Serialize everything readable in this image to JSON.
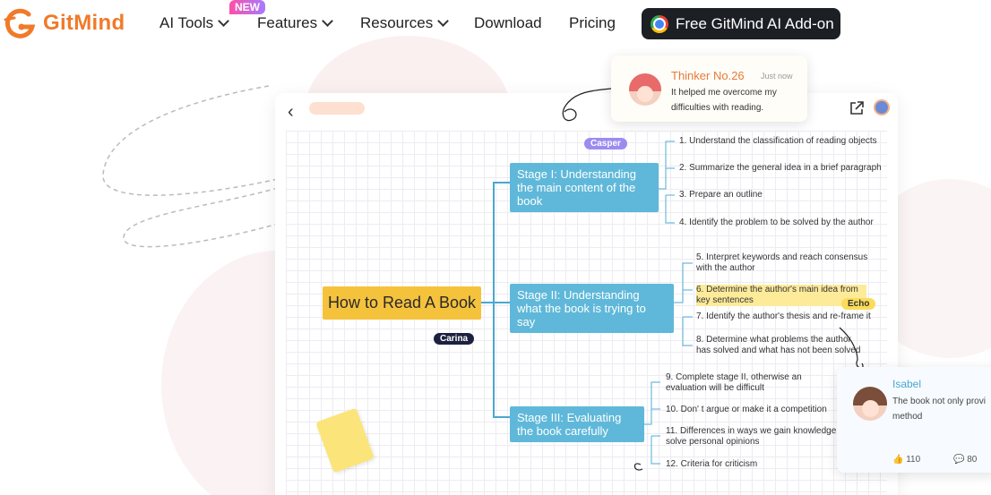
{
  "brand": {
    "name": "GitMind",
    "accent": "#f07a2a"
  },
  "nav": {
    "items": [
      {
        "label": "AI Tools",
        "dropdown": true
      },
      {
        "label": "Features",
        "dropdown": true
      },
      {
        "label": "Resources",
        "dropdown": true
      },
      {
        "label": "Download",
        "dropdown": false
      },
      {
        "label": "Pricing",
        "dropdown": false
      }
    ],
    "new_badge": "NEW",
    "cta_label": "Free GitMind AI Add-on"
  },
  "mindmap": {
    "root": "How to Read A Book",
    "stages": [
      {
        "label": "Stage I: Understanding the main content of the book",
        "leaves": [
          "1. Understand the classification of reading objects",
          "2. Summarize the general idea in a brief paragraph",
          "3. Prepare an outline",
          "4. Identify the problem to be solved by the author"
        ]
      },
      {
        "label": "Stage II: Understanding what the book is trying to say",
        "leaves": [
          "5. Interpret keywords and reach consensus with the author",
          "6. Determine the author's main idea from key sentences",
          "7. Identify the author's thesis and re-frame it",
          "8. Determine what problems the author has solved and what has not been solved"
        ]
      },
      {
        "label": "Stage III: Evaluating the book carefully",
        "leaves": [
          "9. Complete stage II, otherwise an evaluation will be difficult",
          "10. Don' t argue or make it a competition",
          "11. Differences in ways we gain knowledge and solve personal opinions",
          "12. Criteria for criticism"
        ]
      }
    ],
    "tags": {
      "casper": "Casper",
      "carina": "Carina",
      "echo": "Echo"
    }
  },
  "comment1": {
    "name": "Thinker No.26",
    "time": "Just now",
    "text": "It helped me overcome my difficulties with reading."
  },
  "comment2": {
    "name": "Isabel",
    "text": "The book not only provi method",
    "likes": "110",
    "comments": "80"
  }
}
